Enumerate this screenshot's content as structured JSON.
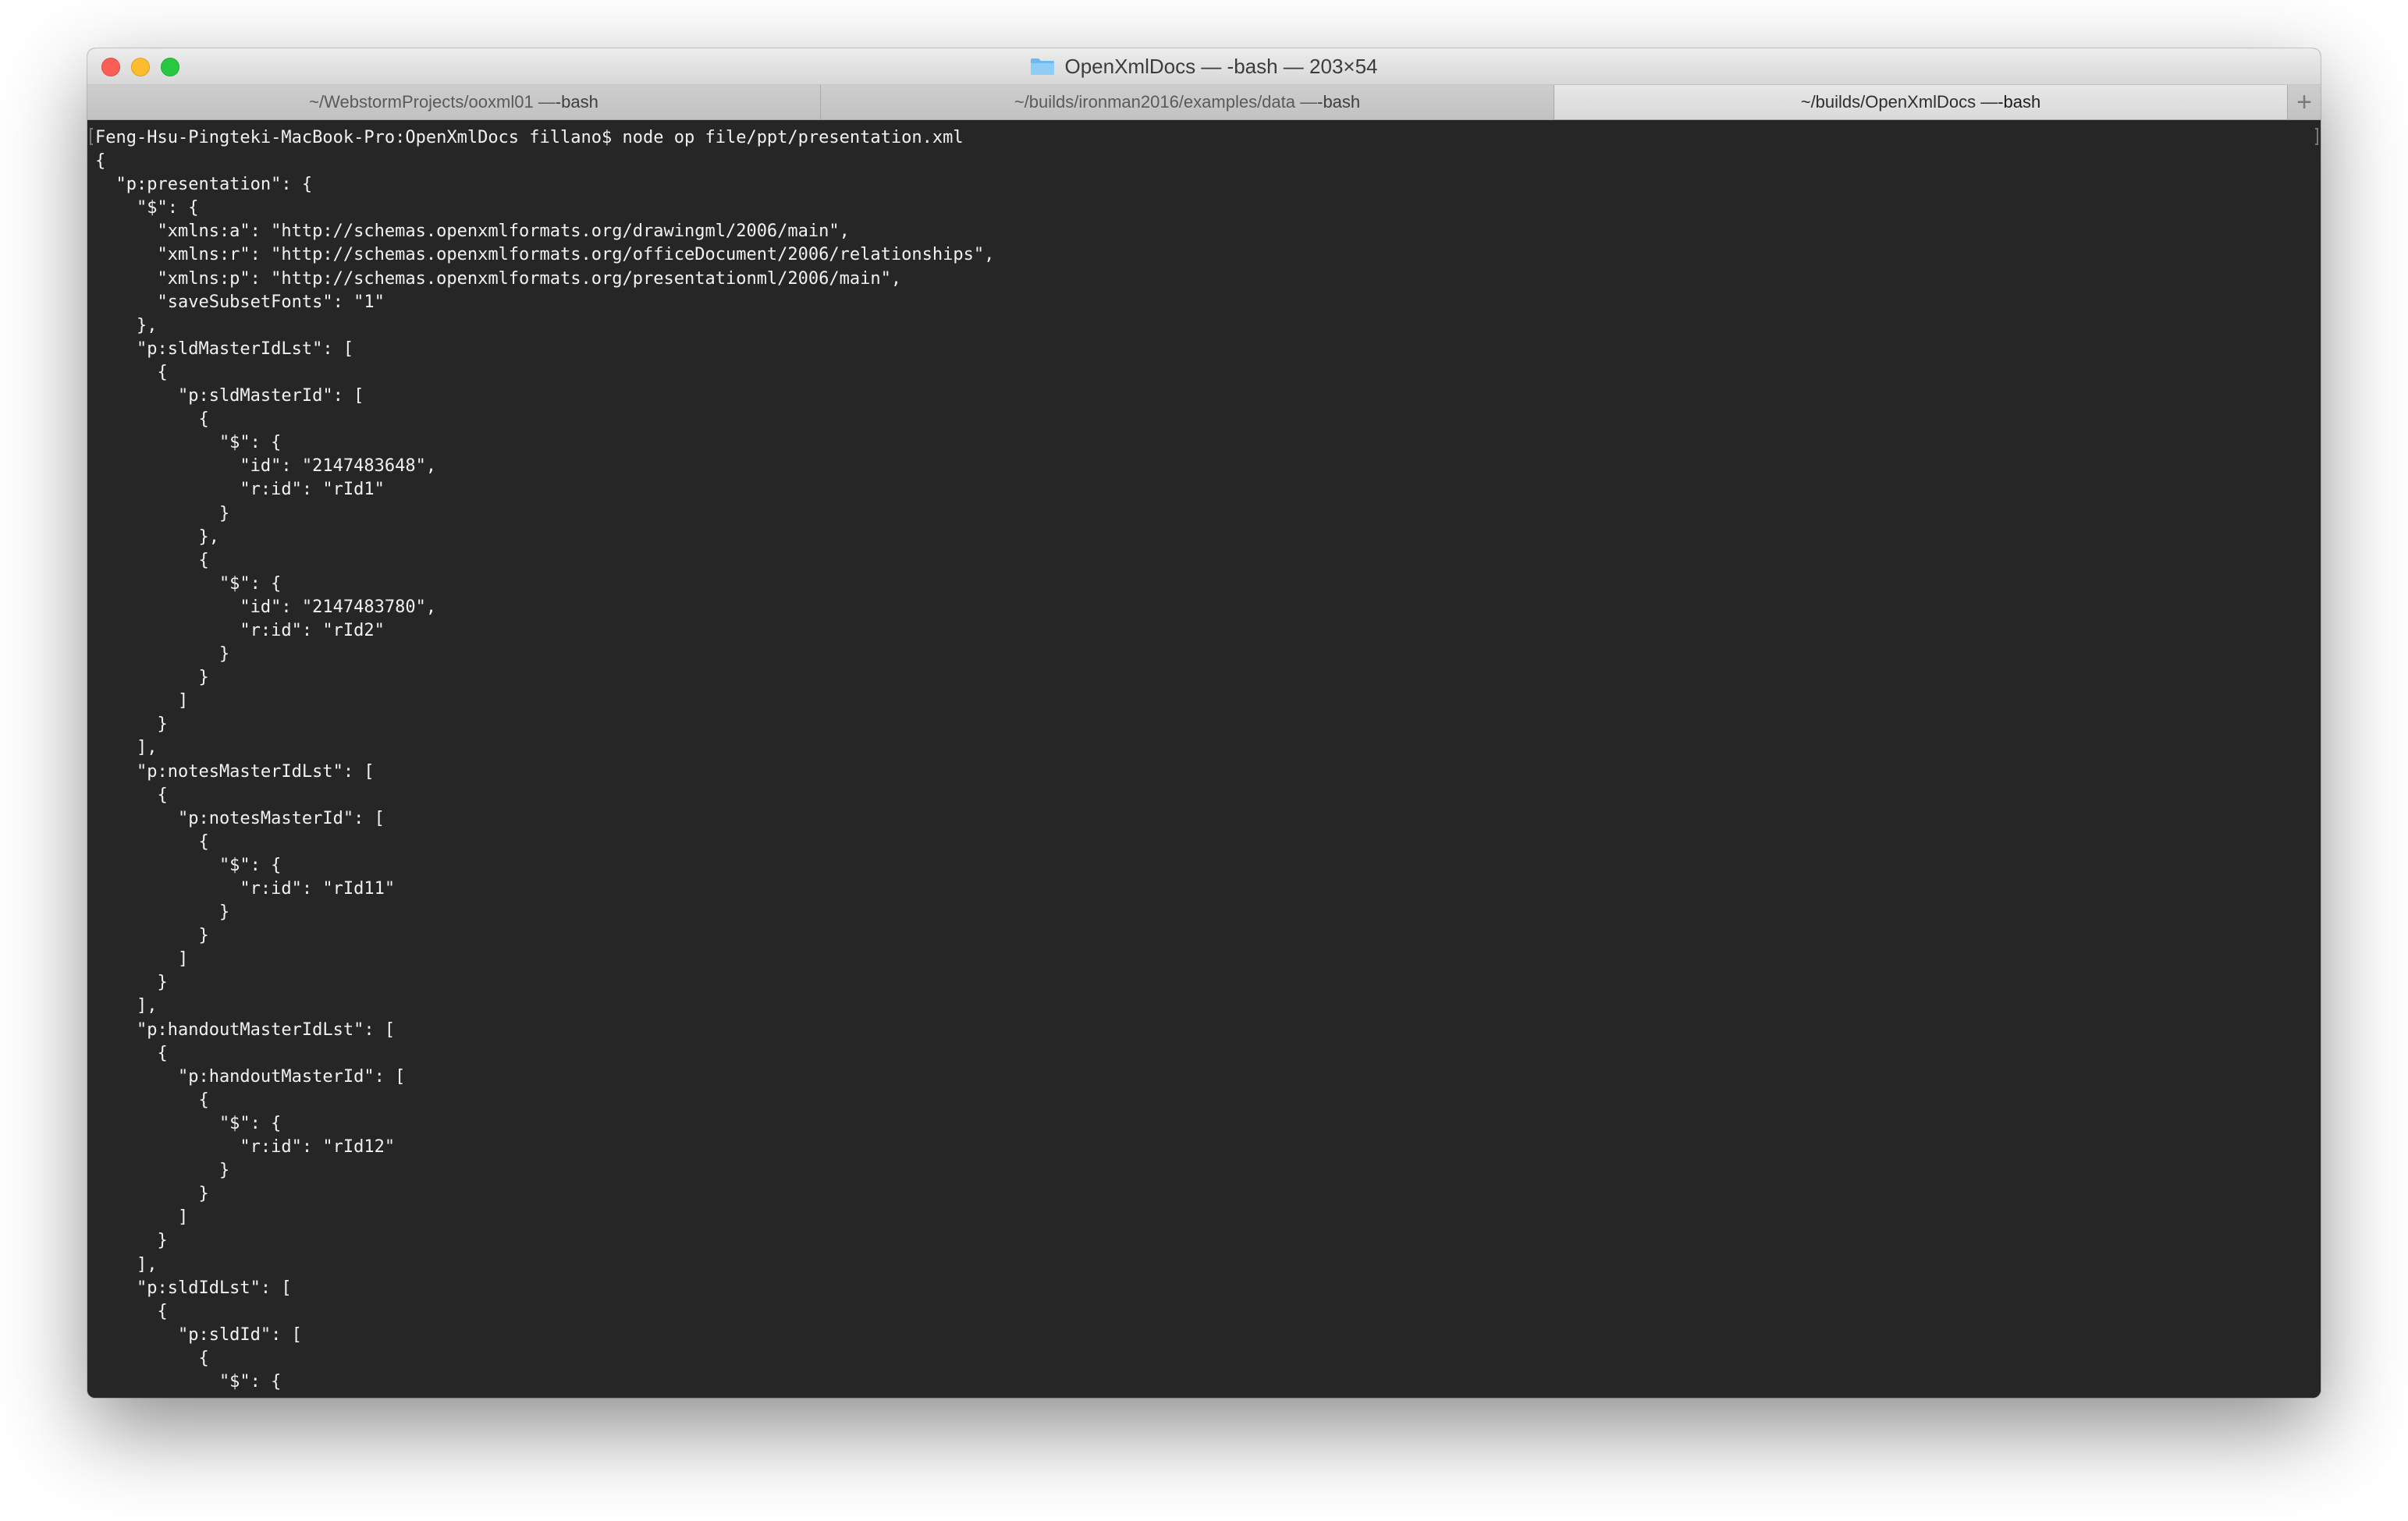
{
  "window": {
    "title": "OpenXmlDocs — -bash — 203×54",
    "folder_icon": "folder-icon",
    "traffic_lights": {
      "close_color": "#fc5f57",
      "minimize_color": "#fdbc2e",
      "maximize_color": "#28c840"
    }
  },
  "tabs": [
    {
      "path": "~/WebstormProjects/ooxml01 — ",
      "cmd": "-bash",
      "active": false
    },
    {
      "path": "~/builds/ironman2016/examples/data — ",
      "cmd": "-bash",
      "active": false
    },
    {
      "path": "~/builds/OpenXmlDocs — ",
      "cmd": "-bash",
      "active": true
    }
  ],
  "new_tab_label": "+",
  "terminal": {
    "background": "#262626",
    "foreground": "#f2f2f2",
    "lines": [
      "Feng-Hsu-Pingteki-MacBook-Pro:OpenXmlDocs fillano$ node op file/ppt/presentation.xml",
      "{",
      "  \"p:presentation\": {",
      "    \"$\": {",
      "      \"xmlns:a\": \"http://schemas.openxmlformats.org/drawingml/2006/main\",",
      "      \"xmlns:r\": \"http://schemas.openxmlformats.org/officeDocument/2006/relationships\",",
      "      \"xmlns:p\": \"http://schemas.openxmlformats.org/presentationml/2006/main\",",
      "      \"saveSubsetFonts\": \"1\"",
      "    },",
      "    \"p:sldMasterIdLst\": [",
      "      {",
      "        \"p:sldMasterId\": [",
      "          {",
      "            \"$\": {",
      "              \"id\": \"2147483648\",",
      "              \"r:id\": \"rId1\"",
      "            }",
      "          },",
      "          {",
      "            \"$\": {",
      "              \"id\": \"2147483780\",",
      "              \"r:id\": \"rId2\"",
      "            }",
      "          }",
      "        ]",
      "      }",
      "    ],",
      "    \"p:notesMasterIdLst\": [",
      "      {",
      "        \"p:notesMasterId\": [",
      "          {",
      "            \"$\": {",
      "              \"r:id\": \"rId11\"",
      "            }",
      "          }",
      "        ]",
      "      }",
      "    ],",
      "    \"p:handoutMasterIdLst\": [",
      "      {",
      "        \"p:handoutMasterId\": [",
      "          {",
      "            \"$\": {",
      "              \"r:id\": \"rId12\"",
      "            }",
      "          }",
      "        ]",
      "      }",
      "    ],",
      "    \"p:sldIdLst\": [",
      "      {",
      "        \"p:sldId\": [",
      "          {",
      "            \"$\": {"
    ]
  }
}
